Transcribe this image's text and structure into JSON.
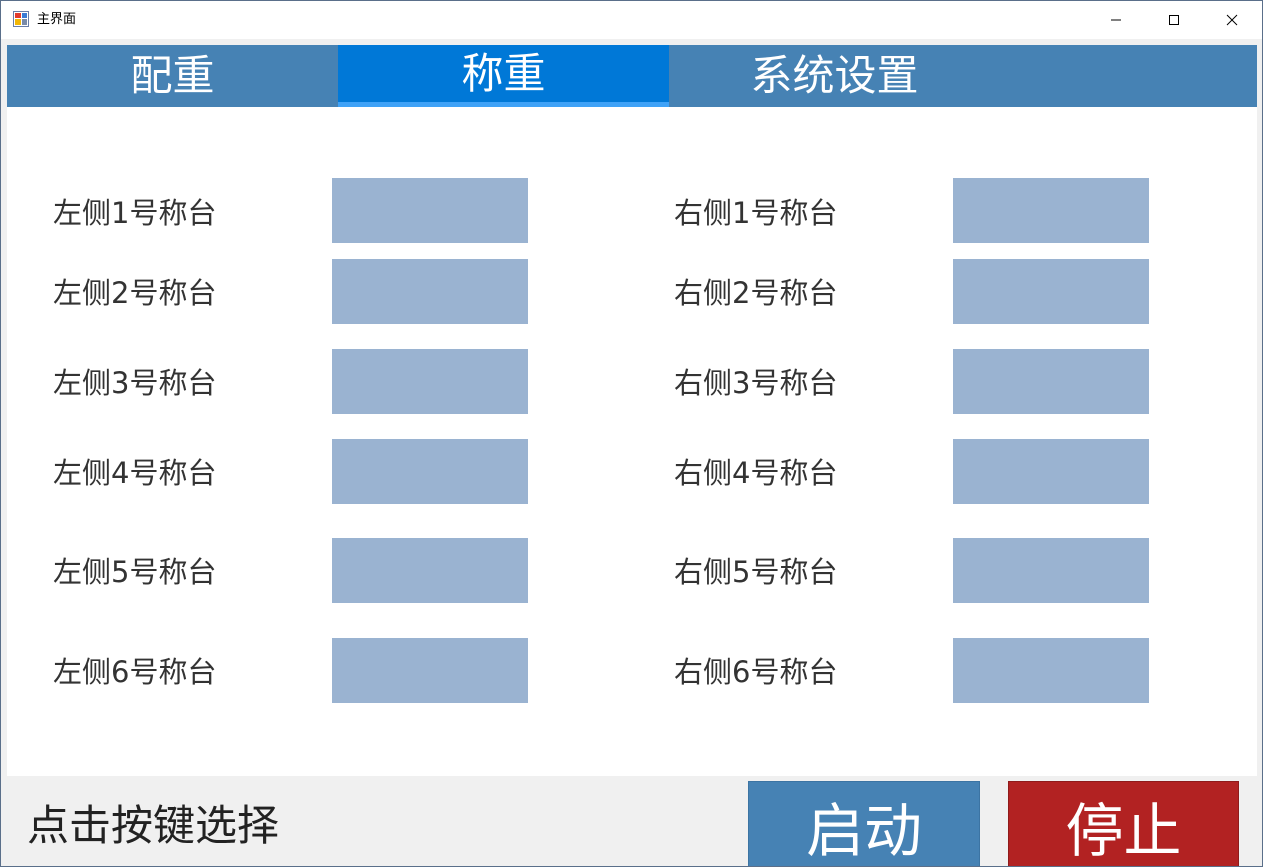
{
  "window": {
    "title": "主界面"
  },
  "tabs": [
    {
      "label": "配重"
    },
    {
      "label": "称重"
    },
    {
      "label": "系统设置"
    }
  ],
  "left_scales": [
    {
      "label": "左侧1号称台",
      "value": ""
    },
    {
      "label": "左侧2号称台",
      "value": ""
    },
    {
      "label": "左侧3号称台",
      "value": ""
    },
    {
      "label": "左侧4号称台",
      "value": ""
    },
    {
      "label": "左侧5号称台",
      "value": ""
    },
    {
      "label": "左侧6号称台",
      "value": ""
    }
  ],
  "right_scales": [
    {
      "label": "右侧1号称台",
      "value": ""
    },
    {
      "label": "右侧2号称台",
      "value": ""
    },
    {
      "label": "右侧3号称台",
      "value": ""
    },
    {
      "label": "右侧4号称台",
      "value": ""
    },
    {
      "label": "右侧5号称台",
      "value": ""
    },
    {
      "label": "右侧6号称台",
      "value": ""
    }
  ],
  "footer": {
    "status": "点击按键选择",
    "start_label": "启动",
    "stop_label": "停止"
  },
  "colors": {
    "tab_bar": "#4682b4",
    "tab_active": "#0078d7",
    "value_box": "#9ab3d1",
    "start_button": "#4682b4",
    "stop_button": "#b22222"
  },
  "icons": {
    "app": "app-icon",
    "minimize": "minimize-icon",
    "maximize": "maximize-icon",
    "close": "close-icon"
  }
}
